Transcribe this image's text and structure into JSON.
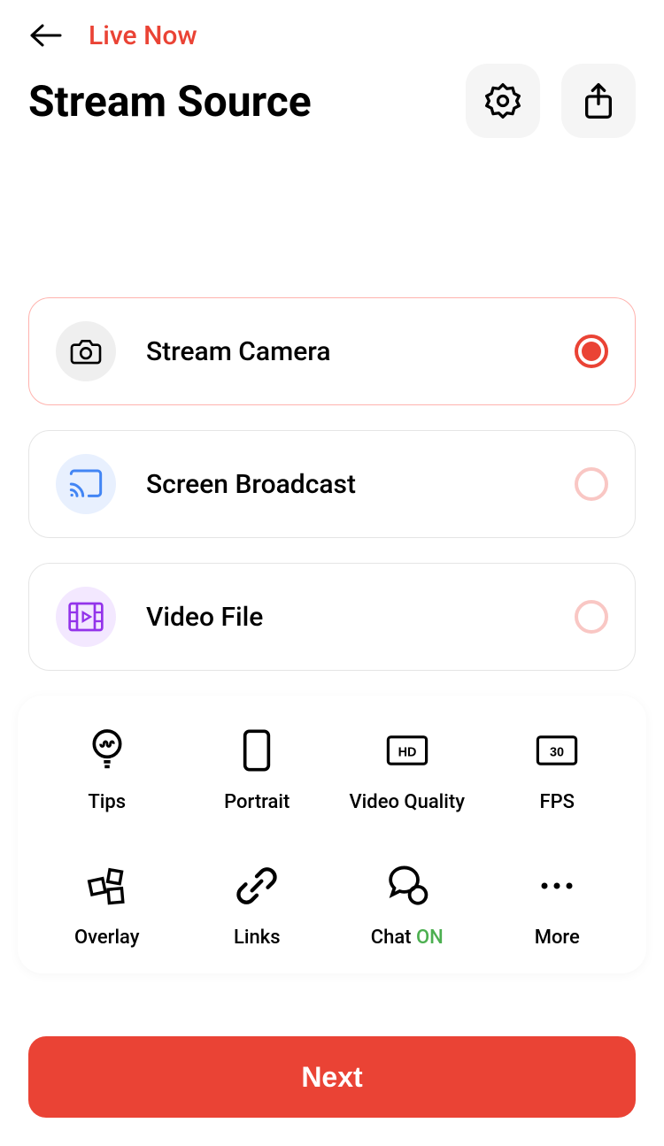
{
  "header": {
    "live_now": "Live Now",
    "title": "Stream Source"
  },
  "sources": [
    {
      "label": "Stream Camera",
      "selected": true
    },
    {
      "label": "Screen Broadcast",
      "selected": false
    },
    {
      "label": "Video File",
      "selected": false
    }
  ],
  "options": {
    "tips": "Tips",
    "portrait": "Portrait",
    "video_quality": "Video Quality",
    "hd_badge": "HD",
    "fps": "FPS",
    "fps_value": "30",
    "overlay": "Overlay",
    "links": "Links",
    "chat": "Chat",
    "chat_state": "ON",
    "more": "More"
  },
  "next_button": "Next"
}
